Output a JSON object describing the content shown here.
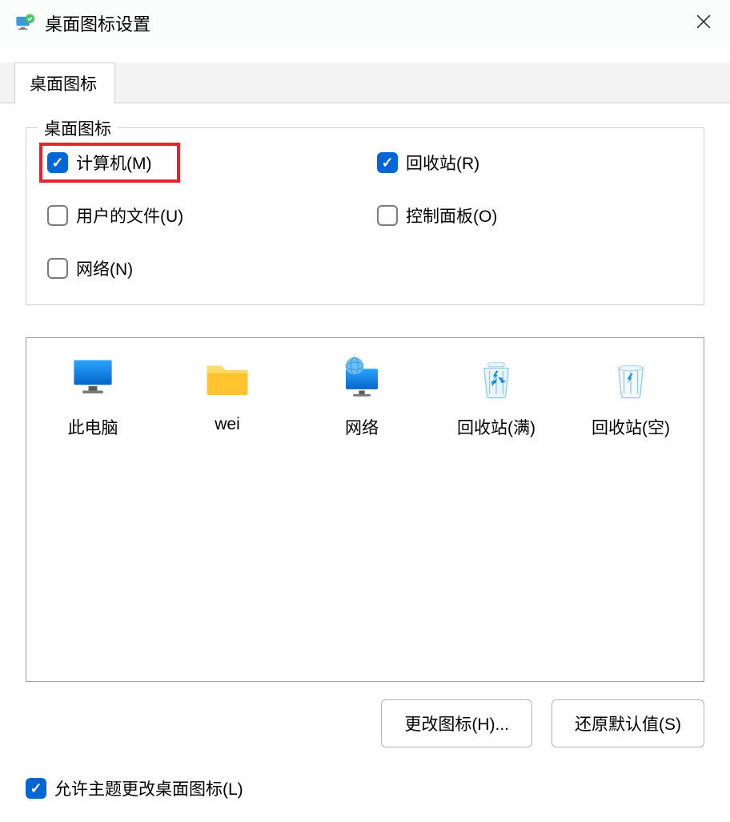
{
  "window": {
    "title": "桌面图标设置"
  },
  "tab": {
    "label": "桌面图标"
  },
  "fieldset": {
    "legend": "桌面图标",
    "checks": {
      "computer": {
        "label": "计算机(M)",
        "checked": true,
        "highlighted": true
      },
      "recycle": {
        "label": "回收站(R)",
        "checked": true
      },
      "userdocs": {
        "label": "用户的文件(U)",
        "checked": false
      },
      "control": {
        "label": "控制面板(O)",
        "checked": false
      },
      "network": {
        "label": "网络(N)",
        "checked": false
      }
    }
  },
  "preview": {
    "items": [
      {
        "id": "this-pc",
        "label": "此电脑"
      },
      {
        "id": "wei",
        "label": "wei"
      },
      {
        "id": "net",
        "label": "网络"
      },
      {
        "id": "bin-full",
        "label": "回收站(满)"
      },
      {
        "id": "bin-empty",
        "label": "回收站(空)"
      }
    ]
  },
  "buttons": {
    "change_icon": "更改图标(H)...",
    "restore_default": "还原默认值(S)"
  },
  "allow_theme": {
    "label": "允许主题更改桌面图标(L)",
    "checked": true
  }
}
